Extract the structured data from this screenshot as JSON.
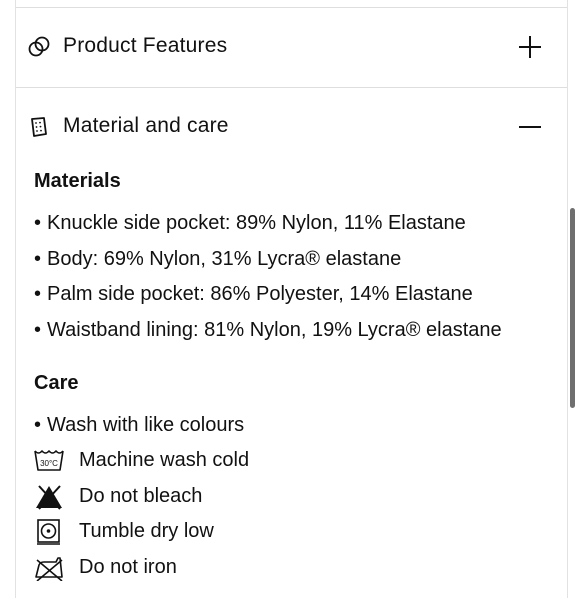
{
  "accordion": {
    "features": {
      "title": "Product Features",
      "icon": "product-features-icon",
      "state": "collapsed"
    },
    "material": {
      "title": "Material and care",
      "icon": "fabric-swatch-icon",
      "state": "expanded"
    }
  },
  "materials": {
    "heading": "Materials",
    "items": [
      "Knuckle side pocket: 89% Nylon, 11% Elastane",
      "Body: 69% Nylon, 31% Lycra® elastane",
      "Palm side pocket: 86% Polyester, 14% Elastane",
      "Waistband lining: 81% Nylon, 19% Lycra® elastane"
    ]
  },
  "care": {
    "heading": "Care",
    "bullet": "Wash with like colours",
    "instructions": [
      {
        "icon": "machine-wash-30-icon",
        "label": "Machine wash cold",
        "icon_text": "30°C"
      },
      {
        "icon": "do-not-bleach-icon",
        "label": "Do not bleach"
      },
      {
        "icon": "tumble-dry-low-icon",
        "label": "Tumble dry low"
      },
      {
        "icon": "do-not-iron-icon",
        "label": "Do not iron"
      }
    ]
  }
}
